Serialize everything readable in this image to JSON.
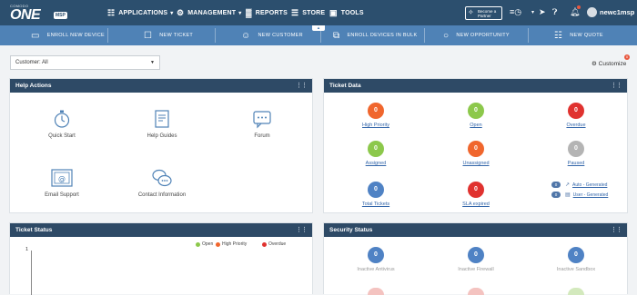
{
  "brand": {
    "small": "COMODO",
    "name": "ONE",
    "badge": "MSP"
  },
  "nav": [
    {
      "label": "APPLICATIONS",
      "icon": "grid-icon",
      "caret": true
    },
    {
      "label": "MANAGEMENT",
      "icon": "gear-icon",
      "caret": true
    },
    {
      "label": "REPORTS",
      "icon": "bar-chart-icon",
      "caret": false
    },
    {
      "label": "STORE",
      "icon": "cart-icon",
      "caret": false
    },
    {
      "label": "TOOLS",
      "icon": "toolbox-icon",
      "caret": false
    }
  ],
  "partner": {
    "line1": "Become a",
    "line2": "Partner"
  },
  "user": {
    "name": "newc1msp"
  },
  "quick_actions": [
    {
      "label": "ENROLL NEW DEVICE",
      "icon": "monitor-icon"
    },
    {
      "label": "NEW TICKET",
      "icon": "bookmark-icon"
    },
    {
      "label": "NEW CUSTOMER",
      "icon": "person-icon"
    },
    {
      "label": "ENROLL DEVICES IN BULK",
      "icon": "devices-bulk-icon"
    },
    {
      "label": "NEW OPPORTUNITY",
      "icon": "lightbulb-icon"
    },
    {
      "label": "NEW QUOTE",
      "icon": "document-icon"
    }
  ],
  "customer_filter": {
    "value": "Customer: All"
  },
  "customize": {
    "label": "Customize",
    "badge": "0"
  },
  "help_actions": {
    "title": "Help Actions",
    "items": [
      {
        "label": "Quick Start",
        "icon": "stopwatch-icon"
      },
      {
        "label": "Help Guides",
        "icon": "book-icon"
      },
      {
        "label": "Forum",
        "icon": "chat-bubble-icon"
      },
      {
        "label": "Email Support",
        "icon": "email-icon"
      },
      {
        "label": "Contact Information",
        "icon": "speech-bubbles-icon"
      }
    ]
  },
  "ticket_data": {
    "title": "Ticket Data",
    "items": [
      {
        "label": "High Priority",
        "value": "0",
        "color": "#f0662d"
      },
      {
        "label": "Open",
        "value": "0",
        "color": "#8cc84b"
      },
      {
        "label": "Overdue",
        "value": "0",
        "color": "#e0322f"
      },
      {
        "label": "Assigned",
        "value": "0",
        "color": "#8cc84b"
      },
      {
        "label": "Unassigned",
        "value": "0",
        "color": "#f0662d"
      },
      {
        "label": "Paused",
        "value": "0",
        "color": "#b4b4b4"
      },
      {
        "label": "Total Tickets",
        "value": "0",
        "color": "#4f82c4"
      },
      {
        "label": "SLA expired",
        "value": "0",
        "color": "#e0322f"
      }
    ],
    "generated": [
      {
        "count": "0",
        "label": "Auto - Generated",
        "icon": "wand-icon"
      },
      {
        "count": "0",
        "label": "User - Generated",
        "icon": "doc-icon"
      }
    ]
  },
  "ticket_status": {
    "title": "Ticket Status",
    "y_tick": "1",
    "legend": [
      {
        "label": "Open",
        "color": "#8cc84b"
      },
      {
        "label": "High Priority",
        "color": "#f0662d"
      },
      {
        "label": "Overdue",
        "color": "#e0322f"
      }
    ]
  },
  "security_status": {
    "title": "Security Status",
    "items": [
      {
        "label": "Inactive Antivirus",
        "value": "0"
      },
      {
        "label": "Inactive Firewall",
        "value": "0"
      },
      {
        "label": "Inactive Sandbox",
        "value": "0"
      }
    ]
  }
}
